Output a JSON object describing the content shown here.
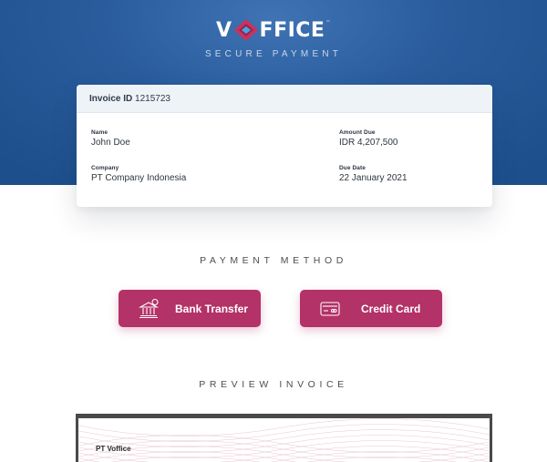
{
  "brand": {
    "logo_left": "V",
    "logo_right": "FFICE",
    "logo_tm": "™",
    "tagline": "SECURE PAYMENT",
    "colors": {
      "header": "#2a5c9d",
      "accent": "#b33267",
      "logo_red": "#c8335f",
      "logo_blue": "#3fa9e0"
    }
  },
  "invoice": {
    "id_label": "Invoice ID",
    "id_value": "1215723",
    "name_label": "Name",
    "name_value": "John Doe",
    "company_label": "Company",
    "company_value": "PT Company Indonesia",
    "amount_label": "Amount Due",
    "amount_value": "IDR 4,207,500",
    "due_label": "Due Date",
    "due_value": "22 January 2021"
  },
  "payment": {
    "title": "PAYMENT METHOD",
    "bank_transfer": {
      "label": "Bank Transfer",
      "icon": "bank-icon"
    },
    "credit_card": {
      "label": "Credit Card",
      "icon": "credit-card-icon"
    }
  },
  "preview": {
    "title": "PREVIEW INVOICE",
    "company": "PT Voffice"
  }
}
